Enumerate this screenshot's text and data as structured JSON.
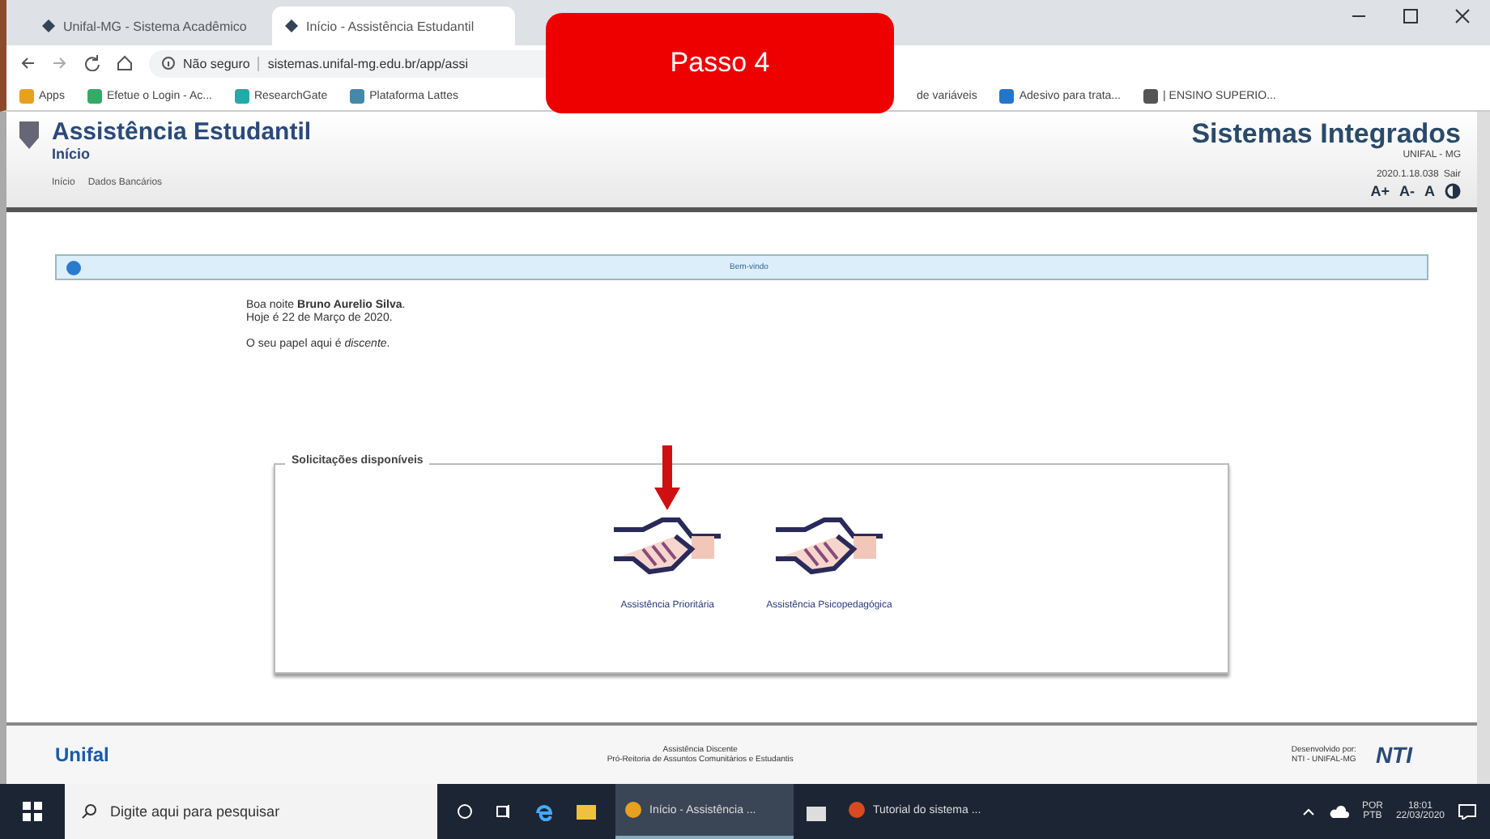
{
  "browser": {
    "tabs": [
      {
        "title": "Unifal-MG - Sistema Acadêmico",
        "selected": false
      },
      {
        "title": "Início - Assistência Estudantil",
        "selected": true
      }
    ],
    "address": {
      "security": "Não seguro",
      "url": "sistemas.unifal-mg.edu.br/app/assi"
    },
    "bookmarks": [
      "Apps",
      "Efetue o Login - Ac...",
      "ResearchGate",
      "Plataforma Lattes",
      "de variáveis",
      "Adesivo para trata...",
      "| ENSINO SUPERIO..."
    ]
  },
  "overlay": {
    "text": "Passo 4"
  },
  "app": {
    "title": "Assistência Estudantil",
    "subtitle": "Início",
    "menu": [
      "Início",
      "Dados Bancários"
    ],
    "brand": "Sistemas Integrados",
    "brand_sub": "UNIFAL - MG",
    "version": "2020.1.18.038",
    "logout": "Sair",
    "font_controls": [
      "A+",
      "A-",
      "A"
    ]
  },
  "info": {
    "text": "Bem-vindo"
  },
  "greeting": {
    "hello": "Boa noite **Bruno Aurelio Silva**.",
    "date": "Hoje é 22 de Março de 2020.",
    "role": "O seu papel aqui é *discente*."
  },
  "panel": {
    "legend": "Solicitações disponíveis",
    "options": [
      {
        "label": "Assistência Prioritária",
        "marked": true
      },
      {
        "label": "Assistência Psicopedagógica",
        "marked": false
      }
    ]
  },
  "footer": {
    "logo": "Unifal",
    "lines": [
      "Assistência Discente",
      "Pró-Reitoria de Assuntos Comunitários e Estudantis"
    ],
    "dev_label": "Desenvolvido por:",
    "dev_name": "NTI - UNIFAL-MG",
    "dev_logo": "NTI"
  },
  "taskbar": {
    "search": "Digite aqui para pesquisar",
    "apps": [
      {
        "label": "Início - Assistência ...",
        "active": true
      },
      {
        "label": "Tutorial do sistema ...",
        "active": false
      }
    ],
    "lang": "POR",
    "lang2": "PTB",
    "time": "18:01",
    "date": "22/03/2020"
  }
}
